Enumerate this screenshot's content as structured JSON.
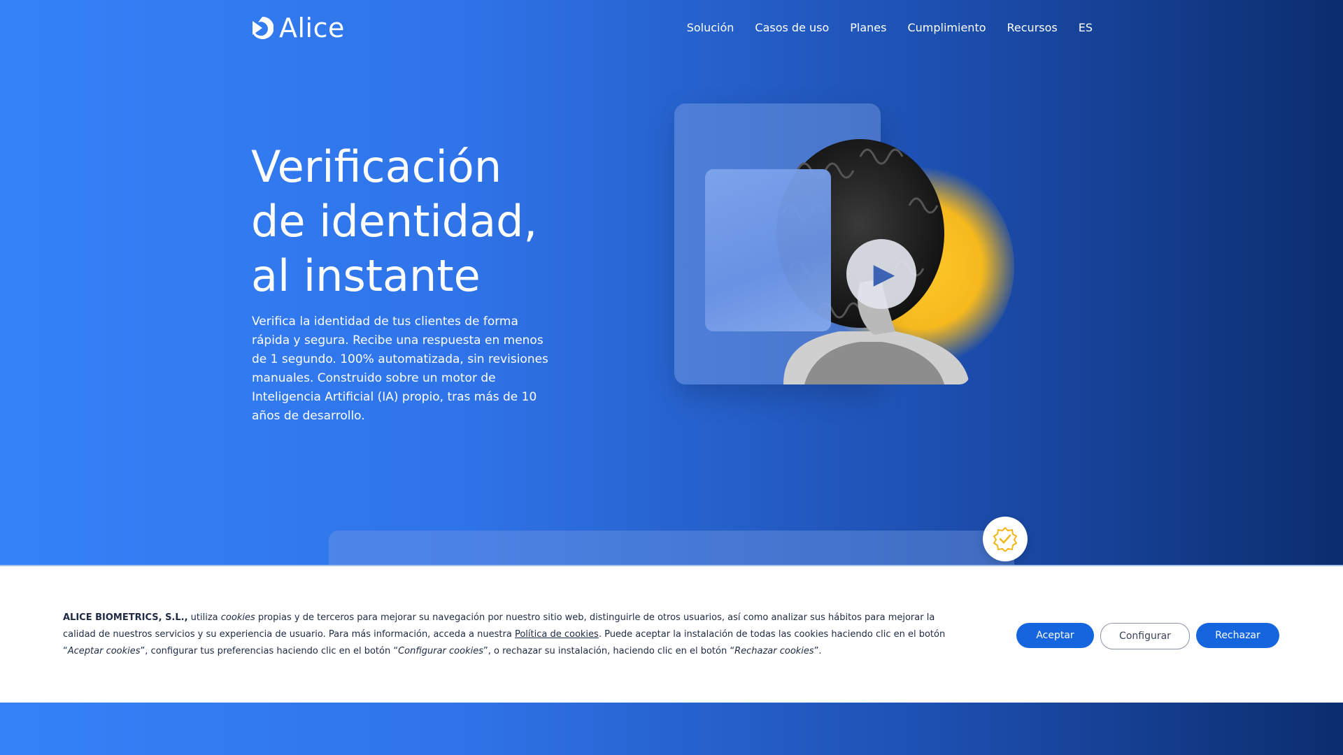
{
  "header": {
    "brand": "Alice",
    "nav": [
      "Solución",
      "Casos de uso",
      "Planes",
      "Cumplimiento",
      "Recursos",
      "ES"
    ]
  },
  "hero": {
    "title_lines": [
      "Verificación",
      "de identidad,",
      "al instante"
    ],
    "description": "Verifica la identidad de tus clientes de forma rápida y segura. Recibe una respuesta en menos de 1 segundo. 100% automatizada, sin revisiones manuales. Construido sobre un motor de Inteligencia Artificial (IA) propio, tras más de 10 años de desarrollo."
  },
  "cookie_banner": {
    "company": "ALICE BIOMETRICS, S.L.,",
    "t1": " utiliza ",
    "cookies_word": "cookies",
    "t2": " propias y de terceros para mejorar su navegación por nuestro sitio web, distinguirle de otros usuarios, así como analizar sus hábitos para mejorar la calidad de nuestros servicios y su experiencia de usuario. Para más información, acceda a nuestra ",
    "policy_link": "Política de cookies",
    "t3": ". Puede aceptar la instalación de todas las cookies haciendo clic en el botón “",
    "accept_ref": "Aceptar cookies",
    "t4": "”, configurar tus preferencias haciendo clic en el botón “",
    "config_ref": "Configurar cookies",
    "t5": "”, o rechazar su instalación, haciendo clic en el botón “",
    "reject_ref": "Rechazar cookies",
    "t6": "”.",
    "buttons": {
      "accept": "Aceptar",
      "configure": "Configurar",
      "reject": "Rechazar"
    }
  },
  "colors": {
    "accent_blue": "#1565df",
    "glow_yellow": "#f5b91e"
  }
}
